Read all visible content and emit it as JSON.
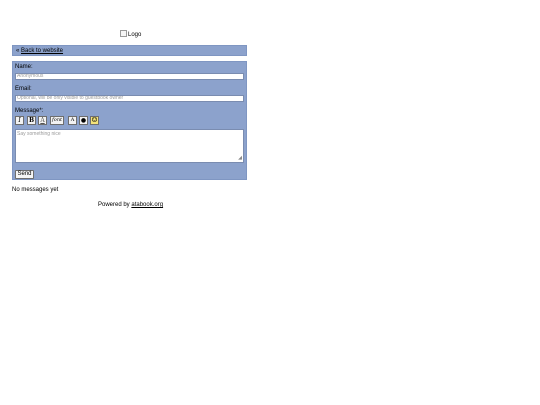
{
  "logo": {
    "alt": "Logo"
  },
  "backbar": {
    "arrow": "«",
    "link": "Back to website"
  },
  "form": {
    "name_label": "Name:",
    "name_placeholder": "Anonymous",
    "email_label": "Email:",
    "email_placeholder": "Optional, will be only visible to guestbook owner",
    "message_label": "Message*:",
    "message_placeholder": "Say something nice",
    "send_label": "Send",
    "toolbar": [
      {
        "name": "italic-button",
        "glyph": "I"
      },
      {
        "name": "bold-button",
        "glyph": "B"
      },
      {
        "name": "underline-button",
        "glyph": "A"
      },
      {
        "name": "font-button",
        "glyph": "font"
      },
      {
        "name": "text-color-button",
        "glyph": "A"
      },
      {
        "name": "background-color-button",
        "glyph": "●"
      },
      {
        "name": "emoticon-button",
        "glyph": "☺"
      }
    ]
  },
  "status": {
    "empty": "No messages yet"
  },
  "footer": {
    "prefix": "Powered by",
    "link": "atabook.org"
  }
}
